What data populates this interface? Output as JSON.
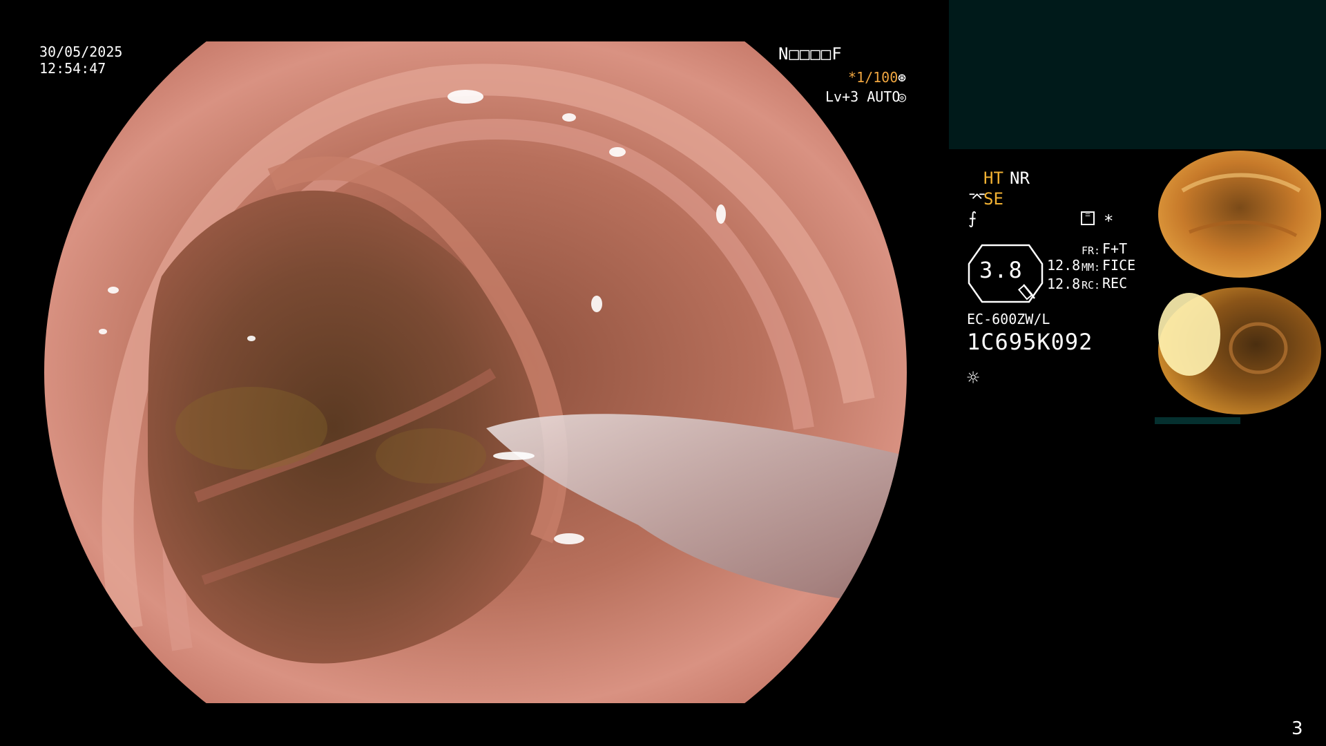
{
  "overlay": {
    "date": "30/05/2025",
    "time": "12:54:47",
    "patient_id": "N□□□□F",
    "shutter": "*1/100",
    "shutter_icon": "⊛",
    "light_level": "Lv+3 AUTO",
    "light_icon": "◎"
  },
  "processor": {
    "ht": "HT",
    "nr": "NR",
    "se_icon": "⌤",
    "se": "SE",
    "enhance_icon": "⨍",
    "grid_icon": "☰",
    "star": "*",
    "zoom": "3.8",
    "value_1": "12.8",
    "value_2": "12.8",
    "fr_label": "FR:",
    "fr_value": "F+T",
    "mm_label": "MM:",
    "mm_value": "FICE",
    "rc_label": "RC:",
    "rc_value": "REC",
    "scope_model": "EC-600ZW/L",
    "serial": "1C695K092",
    "brightness_icon": "☼"
  },
  "page_number": "3",
  "colors": {
    "mucosa": "#c97a66",
    "lumen": "#6b3a2a",
    "banner": "#001a1a",
    "accent_orange": "#f2b233"
  },
  "thumbnails": [
    {
      "label": "captured-frame-1"
    },
    {
      "label": "captured-frame-2"
    }
  ]
}
